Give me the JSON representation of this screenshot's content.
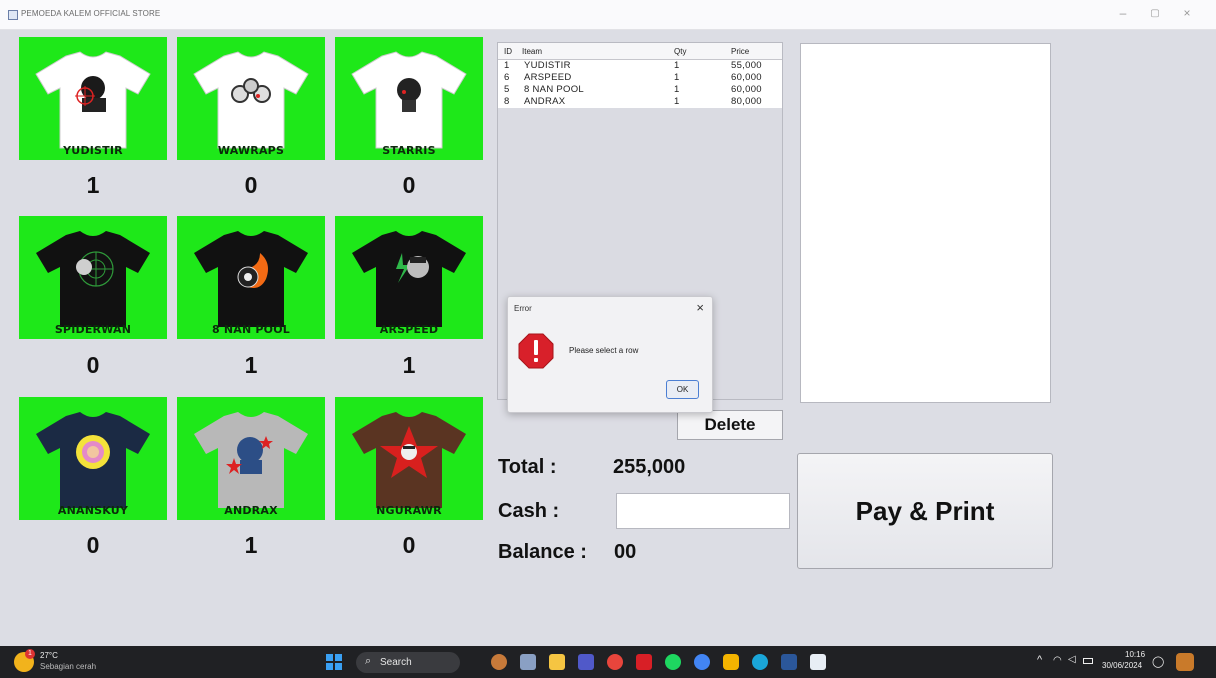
{
  "window": {
    "title": "PEMOEDA KALEM OFFICIAL STORE"
  },
  "products": [
    {
      "name": "YUDISTIR",
      "qty": "1"
    },
    {
      "name": "WAWRAPS",
      "qty": "0"
    },
    {
      "name": "STARRIS",
      "qty": "0"
    },
    {
      "name": "SPIDERWAN",
      "qty": "0"
    },
    {
      "name": "8 NAN POOL",
      "qty": "1"
    },
    {
      "name": "ARSPEED",
      "qty": "1"
    },
    {
      "name": "ANANSKUY",
      "qty": "0"
    },
    {
      "name": "ANDRAX",
      "qty": "1"
    },
    {
      "name": "NGURAWR",
      "qty": "0"
    }
  ],
  "table": {
    "headers": [
      "ID",
      "Iteam",
      "Qty",
      "Price"
    ],
    "rows": [
      [
        "1",
        "YUDISTIR",
        "1",
        "55,000"
      ],
      [
        "6",
        "ARSPEED",
        "1",
        "60,000"
      ],
      [
        "5",
        "8 NAN POOL",
        "1",
        "60,000"
      ],
      [
        "8",
        "ANDRAX",
        "1",
        "80,000"
      ]
    ]
  },
  "buttons": {
    "delete": "Delete",
    "pay": "Pay & Print"
  },
  "summary": {
    "total_label": "Total :",
    "total_value": "255,000",
    "cash_label": "Cash :",
    "cash_value": "",
    "balance_label": "Balance :",
    "balance_value": "00"
  },
  "dialog": {
    "title": "Error",
    "message": "Please select a row",
    "ok": "OK"
  },
  "taskbar": {
    "weather_temp": "27°C",
    "weather_desc": "Sebagian cerah",
    "weather_badge": "1",
    "search": "Search",
    "time": "10:16",
    "date": "30/06/2024"
  },
  "colors": {
    "card_green": "#1ee819",
    "error_red": "#d8202a",
    "ok_border": "#4c7fd3"
  }
}
